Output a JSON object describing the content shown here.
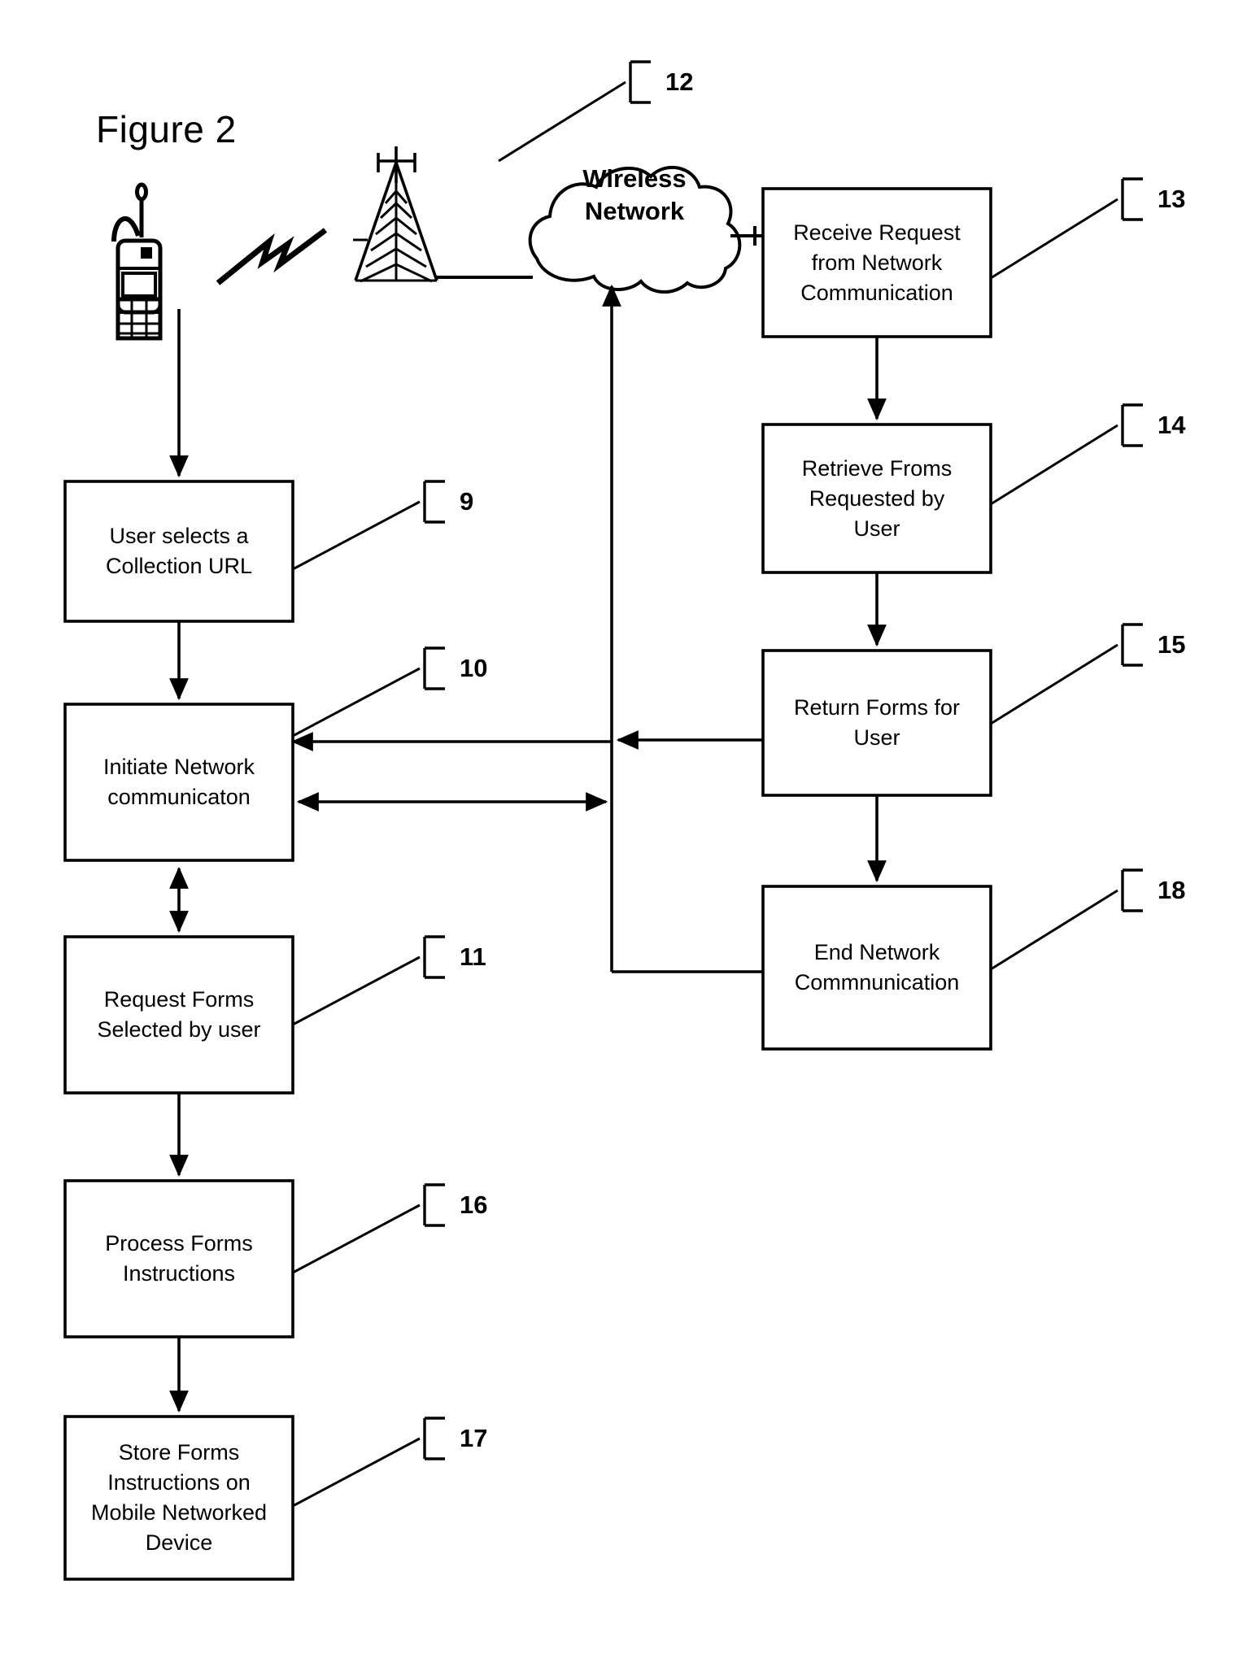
{
  "figure": {
    "title": "Figure 2"
  },
  "cloud": {
    "label": "Wireless\nNetwork"
  },
  "icons": {
    "mobile_phone": "mobile-phone-icon",
    "lightning_bolt": "lightning-bolt-icon",
    "cell_tower": "cell-tower-icon",
    "network_cloud": "network-cloud-icon"
  },
  "left_column": [
    {
      "ref": "9",
      "label": "User selects a\nCollection URL"
    },
    {
      "ref": "10",
      "label": "Initiate Network\ncommunicaton"
    },
    {
      "ref": "11",
      "label": "Request Forms\nSelected by user"
    },
    {
      "ref": "16",
      "label": "Process Forms\nInstructions"
    },
    {
      "ref": "17",
      "label": "Store Forms\nInstructions on\nMobile Networked\nDevice"
    }
  ],
  "right_column": [
    {
      "ref": "13",
      "label": "Receive Request\nfrom Network\nCommunication"
    },
    {
      "ref": "14",
      "label": "Retrieve Froms\nRequested by\nUser"
    },
    {
      "ref": "15",
      "label": "Return Forms for\nUser"
    },
    {
      "ref": "18",
      "label": "End Network\nCommnunication"
    }
  ],
  "network_ref": {
    "ref": "12"
  },
  "colors": {
    "stroke": "#000000",
    "background": "#ffffff"
  }
}
